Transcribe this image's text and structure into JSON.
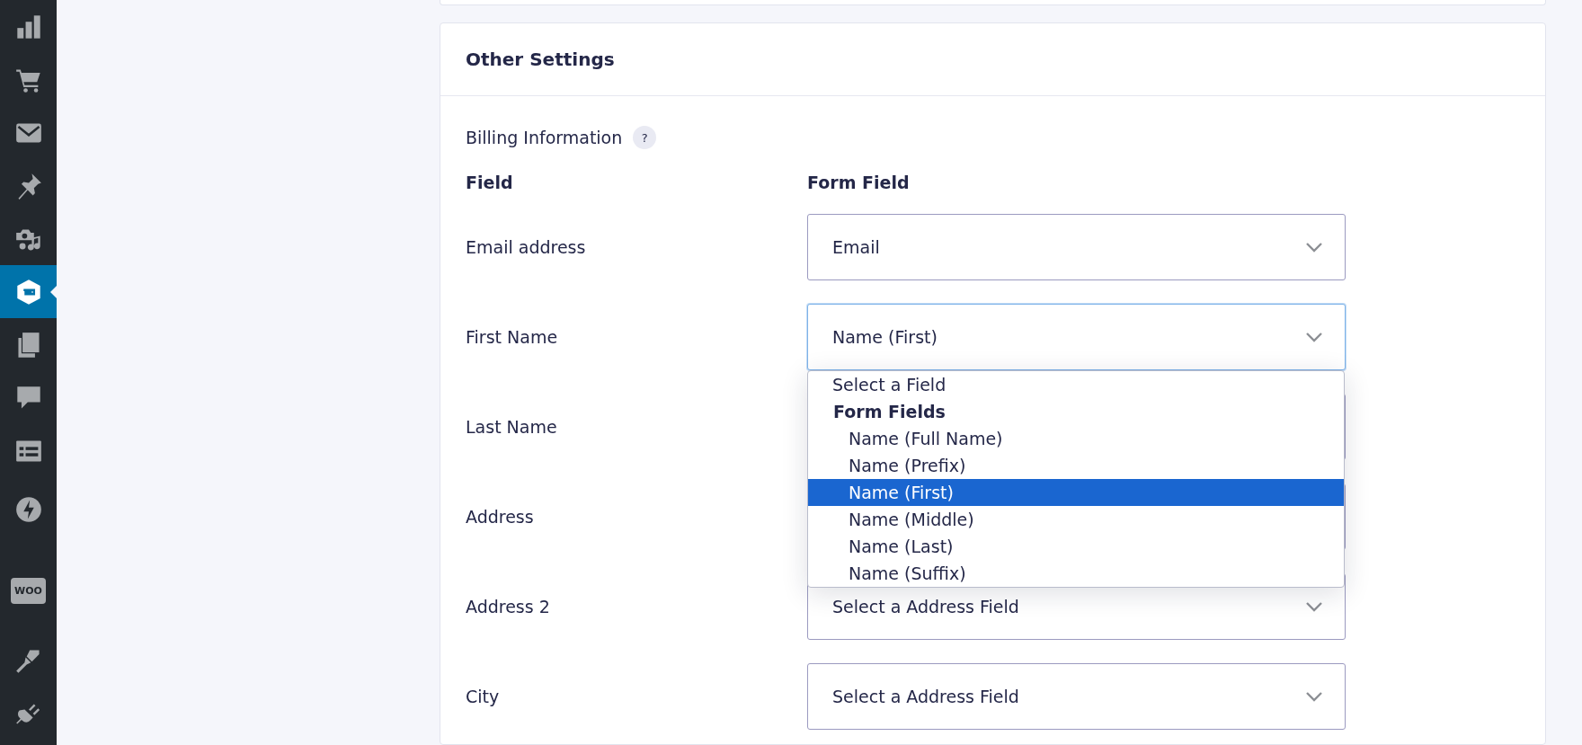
{
  "sidebar": {
    "items": [
      {
        "kind": "chart",
        "selected": false
      },
      {
        "kind": "cart",
        "selected": false
      },
      {
        "kind": "mail",
        "selected": false
      },
      {
        "kind": "pin",
        "selected": false
      },
      {
        "kind": "media",
        "selected": false
      },
      {
        "kind": "forms",
        "selected": true
      },
      {
        "kind": "pages",
        "selected": false
      },
      {
        "kind": "comment",
        "selected": false
      },
      {
        "kind": "list",
        "selected": false
      },
      {
        "kind": "bolt",
        "selected": false
      },
      {
        "kind": "woo",
        "selected": false,
        "text": "WOO"
      },
      {
        "kind": "brush",
        "selected": false
      },
      {
        "kind": "plug",
        "selected": false
      }
    ]
  },
  "panel": {
    "title": "Other Settings",
    "section": {
      "label": "Billing Information",
      "help": "?"
    },
    "columns": [
      "Field",
      "Form Field"
    ],
    "rows": [
      {
        "label": "Email address",
        "value": "Email",
        "open": false
      },
      {
        "label": "First Name",
        "value": "Name (First)",
        "open": true,
        "options": [
          {
            "kind": "option",
            "label": "Select a Field",
            "selected": false
          },
          {
            "kind": "group",
            "label": "Form Fields",
            "children": [
              {
                "label": "Name (Full Name)",
                "selected": false
              },
              {
                "label": "Name (Prefix)",
                "selected": false
              },
              {
                "label": "Name (First)",
                "selected": true
              },
              {
                "label": "Name (Middle)",
                "selected": false
              },
              {
                "label": "Name (Last)",
                "selected": false
              },
              {
                "label": "Name (Suffix)",
                "selected": false
              }
            ]
          }
        ]
      },
      {
        "label": "Last Name",
        "open": false
      },
      {
        "label": "Address",
        "open": false
      },
      {
        "label": "Address 2",
        "value": "Select a Address Field",
        "open": false
      },
      {
        "label": "City",
        "value": "Select a Address Field",
        "open": false
      }
    ]
  }
}
